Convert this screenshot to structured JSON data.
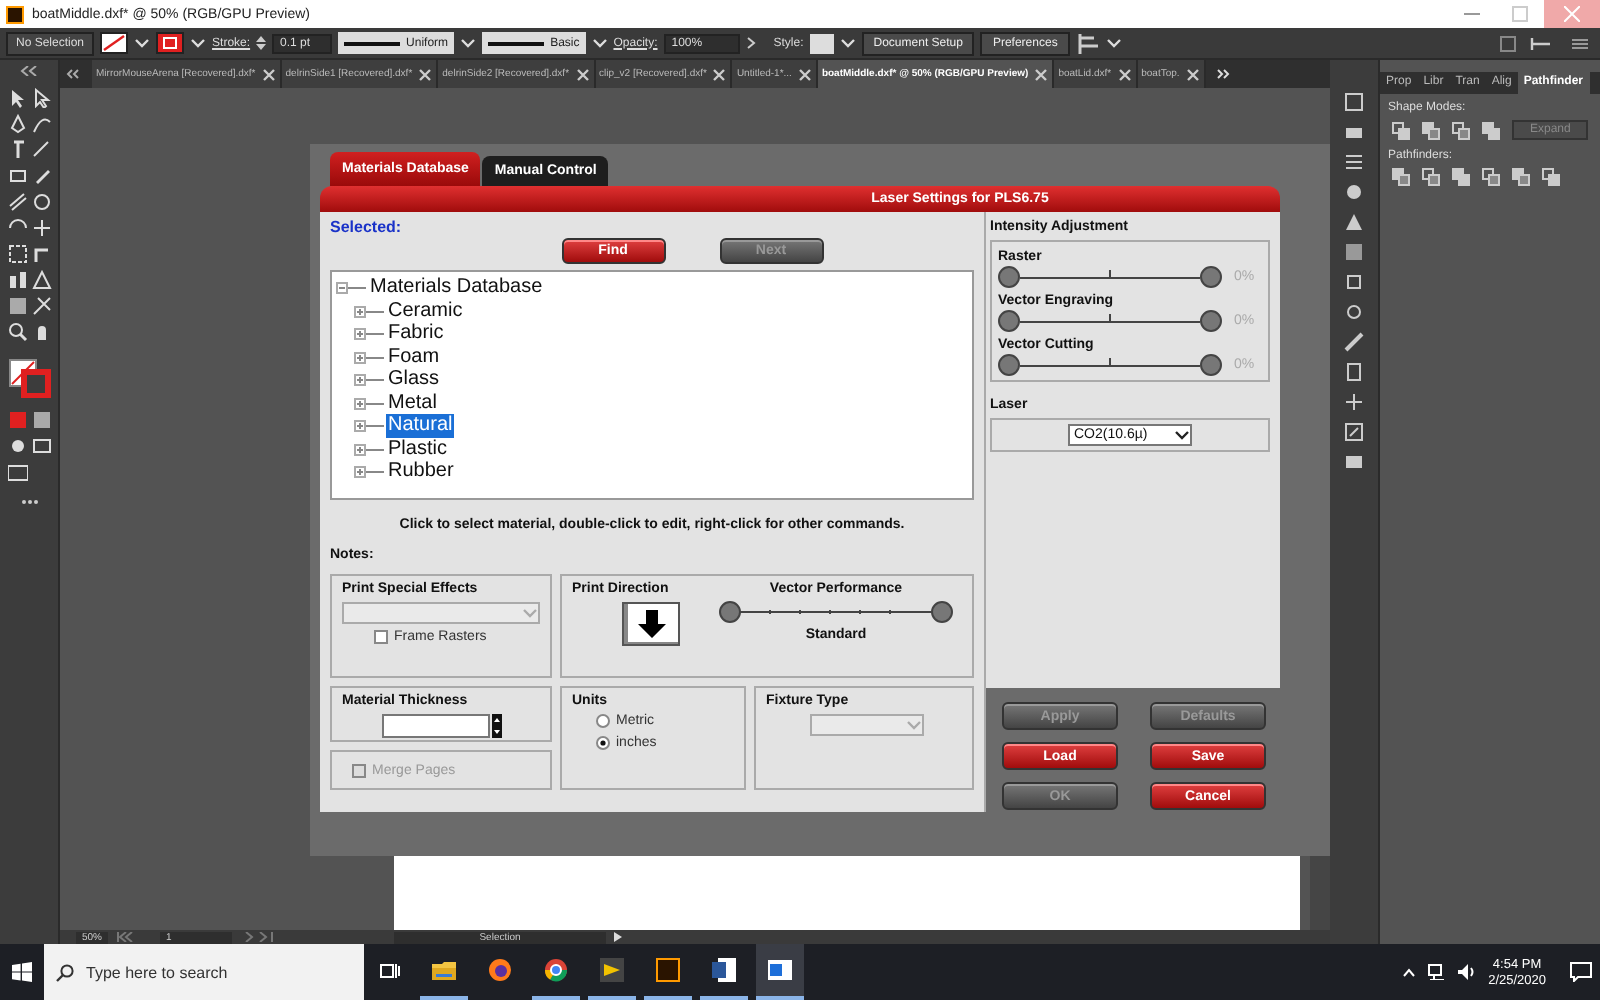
{
  "window": {
    "title": "boatMiddle.dxf* @ 50% (RGB/GPU Preview)"
  },
  "control_bar": {
    "selection": "No Selection",
    "stroke_label": "Stroke:",
    "stroke_weight": "0.1 pt",
    "stroke_profile": "Uniform",
    "brush": "Basic",
    "opacity_label": "Opacity:",
    "opacity": "100%",
    "style_label": "Style:",
    "buttons": [
      "Document Setup",
      "Preferences"
    ]
  },
  "document_tabs": [
    {
      "label": "MirrorMouseArena [Recovered].dxf*",
      "selected": false
    },
    {
      "label": "delrinSide1 [Recovered].dxf*",
      "selected": false
    },
    {
      "label": "delrinSide2 [Recovered].dxf*",
      "selected": false
    },
    {
      "label": "clip_v2 [Recovered].dxf*",
      "selected": false
    },
    {
      "label": "Untitled-1*...",
      "selected": false
    },
    {
      "label": "boatMiddle.dxf* @ 50% (RGB/GPU Preview)",
      "selected": true
    },
    {
      "label": "boatLid.dxf*",
      "selected": false
    },
    {
      "label": "boatTop.",
      "selected": false
    }
  ],
  "panel": {
    "tabs": [
      {
        "label": "Prop",
        "selected": false
      },
      {
        "label": "Libr",
        "selected": false
      },
      {
        "label": "Tran",
        "selected": false
      },
      {
        "label": "Alig",
        "selected": false
      },
      {
        "label": "Pathfinder",
        "selected": true
      }
    ],
    "shape_modes_label": "Shape Modes:",
    "expand_button": {
      "label": "Expand",
      "disabled": true
    },
    "pathfinders_label": "Pathfinders:"
  },
  "dialog": {
    "tabs": [
      {
        "label": "Materials Database",
        "selected": true
      },
      {
        "label": "Manual Control",
        "selected": false
      }
    ],
    "title": "Laser Settings for PLS6.75",
    "selected_label": "Selected:",
    "find_buttons": [
      {
        "label": "Find",
        "disabled": false
      },
      {
        "label": "Next",
        "disabled": true
      }
    ],
    "tree": {
      "label": "Materials Database",
      "selected": false,
      "expanded": true,
      "children": [
        {
          "label": "Ceramic",
          "selected": false,
          "expanded": false
        },
        {
          "label": "Fabric",
          "selected": false,
          "expanded": false
        },
        {
          "label": "Foam",
          "selected": false,
          "expanded": false
        },
        {
          "label": "Glass",
          "selected": false,
          "expanded": false
        },
        {
          "label": "Metal",
          "selected": false,
          "expanded": false
        },
        {
          "label": "Natural",
          "selected": true,
          "expanded": false
        },
        {
          "label": "Plastic",
          "selected": false,
          "expanded": false
        },
        {
          "label": "Rubber",
          "selected": false,
          "expanded": false
        }
      ]
    },
    "hint": "Click to select material, double-click to edit, right-click for other commands.",
    "notes_label": "Notes:",
    "print_special_effects": {
      "title": "Print Special Effects",
      "dropdown": {
        "disabled": true
      },
      "frame_rasters": {
        "label": "Frame Rasters",
        "checked": false
      }
    },
    "material_thickness": {
      "title": "Material Thickness"
    },
    "merge_pages": {
      "label": "Merge Pages",
      "checked": false,
      "disabled": true
    },
    "print_direction": {
      "title": "Print Direction"
    },
    "vector_performance": {
      "title": "Vector Performance",
      "reading": "Standard"
    },
    "units": {
      "title": "Units",
      "options": [
        {
          "label": "Metric",
          "selected": false
        },
        {
          "label": "inches",
          "selected": true
        }
      ]
    },
    "fixture_type": {
      "title": "Fixture Type",
      "dropdown": {
        "disabled": true
      }
    },
    "intensity": {
      "title": "Intensity Adjustment",
      "sliders": [
        {
          "name": "Raster",
          "level": 0.5,
          "reading": "0%"
        },
        {
          "name": "Vector Engraving",
          "level": 0.5,
          "reading": "0%"
        },
        {
          "name": "Vector Cutting",
          "level": 0.5,
          "reading": "0%"
        }
      ]
    },
    "laser": {
      "title": "Laser",
      "value": "CO2(10.6µ)"
    },
    "buttons": [
      {
        "label": "Apply",
        "disabled": true
      },
      {
        "label": "Defaults",
        "disabled": true
      },
      {
        "label": "Load",
        "disabled": false
      },
      {
        "label": "Save",
        "disabled": false
      },
      {
        "label": "OK",
        "disabled": true
      },
      {
        "label": "Cancel",
        "disabled": false
      }
    ]
  },
  "status_bar": {
    "zoom": "50%",
    "artboard": "1",
    "tool": "Selection"
  },
  "taskbar": {
    "search_placeholder": "Type here to search",
    "time": "4:54 PM",
    "date": "2/25/2020",
    "apps": [
      {
        "kind": "folder",
        "running": true,
        "selected": false
      },
      {
        "kind": "globe",
        "running": false,
        "selected": false
      },
      {
        "kind": "wheel",
        "running": true,
        "selected": false
      },
      {
        "kind": "player",
        "running": true,
        "selected": false
      },
      {
        "kind": "design",
        "running": true,
        "selected": false
      },
      {
        "kind": "document",
        "running": true,
        "selected": false
      },
      {
        "kind": "window",
        "running": true,
        "selected": true
      }
    ]
  }
}
